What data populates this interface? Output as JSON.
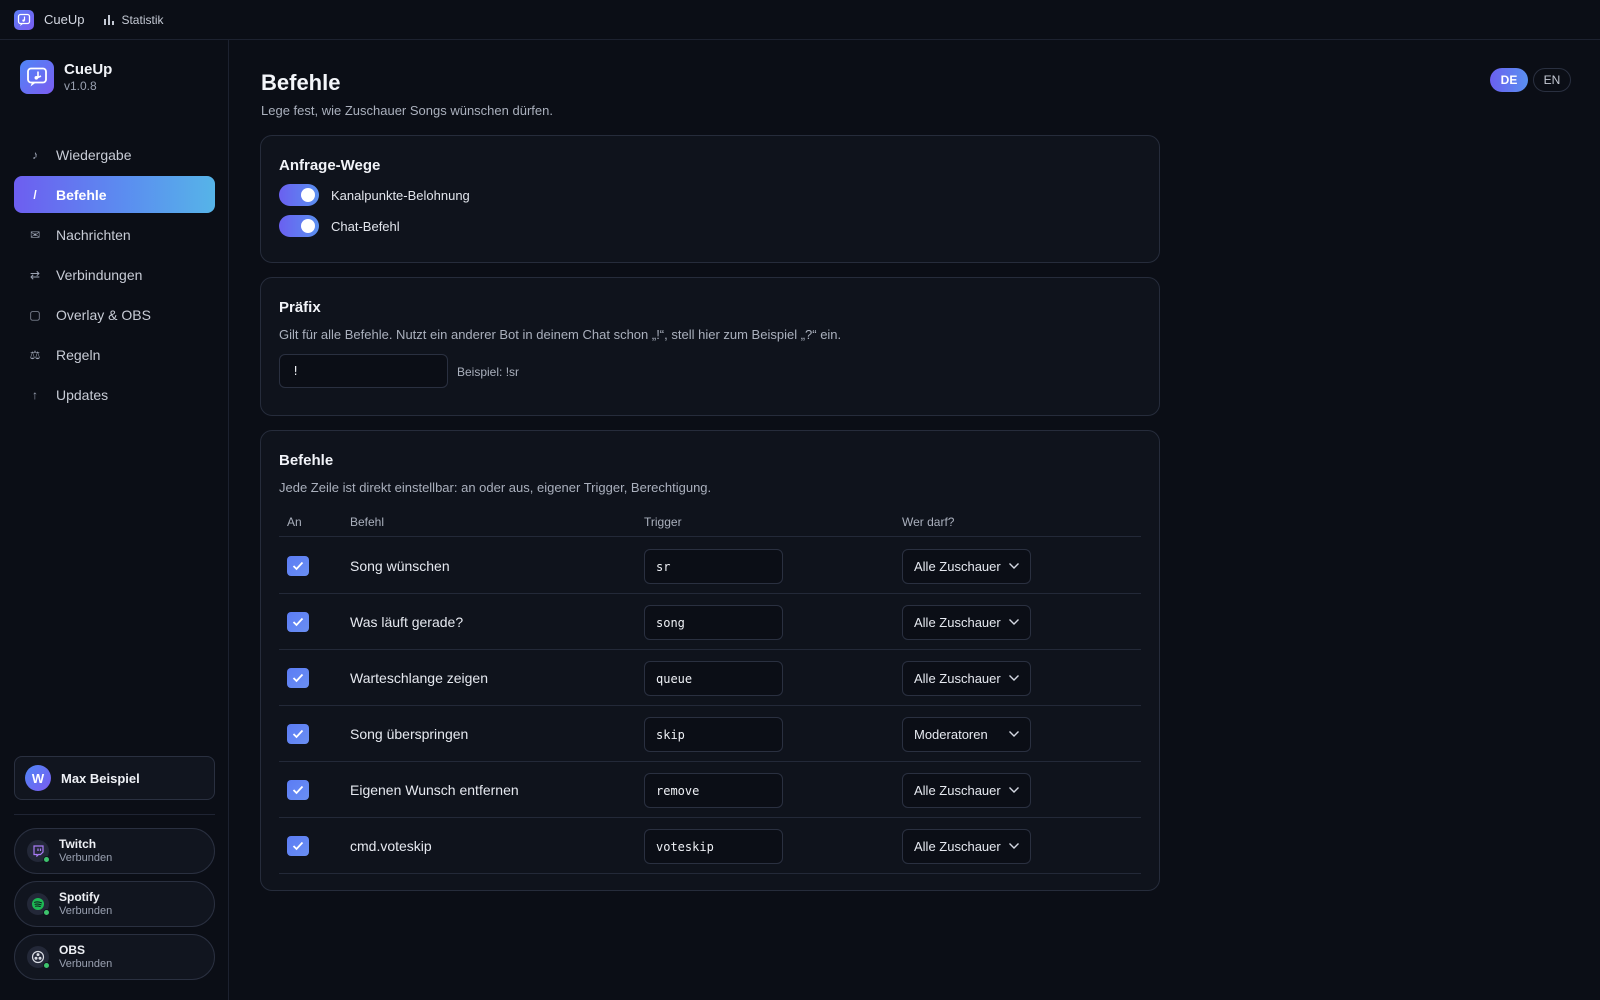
{
  "topbar": {
    "app_name": "CueUp",
    "stats_label": "Statistik"
  },
  "sidebar": {
    "brand": {
      "name": "CueUp",
      "version": "v1.0.8"
    },
    "items": [
      {
        "id": "wiedergabe",
        "label": "Wiedergabe",
        "icon": "♪"
      },
      {
        "id": "befehle",
        "label": "Befehle",
        "icon": "/"
      },
      {
        "id": "nachrichten",
        "label": "Nachrichten",
        "icon": "✉"
      },
      {
        "id": "verbindungen",
        "label": "Verbindungen",
        "icon": "⇄"
      },
      {
        "id": "overlay",
        "label": "Overlay & OBS",
        "icon": "▢"
      },
      {
        "id": "regeln",
        "label": "Regeln",
        "icon": "⚖"
      },
      {
        "id": "updates",
        "label": "Updates",
        "icon": "↑"
      }
    ],
    "active": "befehle",
    "user": {
      "initial": "W",
      "name": "Max Beispiel"
    },
    "services": [
      {
        "name": "Twitch",
        "status": "Verbunden",
        "icon": "twitch-icon"
      },
      {
        "name": "Spotify",
        "status": "Verbunden",
        "icon": "spotify-icon"
      },
      {
        "name": "OBS",
        "status": "Verbunden",
        "icon": "obs-icon"
      }
    ]
  },
  "lang": {
    "de": "DE",
    "en": "EN",
    "selected": "DE"
  },
  "page": {
    "title": "Befehle",
    "subtitle": "Lege fest, wie Zuschauer Songs wünschen dürfen."
  },
  "request_ways": {
    "title": "Anfrage-Wege",
    "channel_points": {
      "label": "Kanalpunkte-Belohnung",
      "enabled": true
    },
    "chat_command": {
      "label": "Chat-Befehl",
      "enabled": true
    }
  },
  "prefix": {
    "title": "Präfix",
    "description": "Gilt für alle Befehle. Nutzt ein anderer Bot in deinem Chat schon „!“, stell hier zum Beispiel „?“ ein.",
    "value": "!",
    "example": "Beispiel: !sr"
  },
  "commands": {
    "title": "Befehle",
    "description": "Jede Zeile ist direkt einstellbar: an oder aus, eigener Trigger, Berechtigung.",
    "headers": {
      "on": "An",
      "command": "Befehl",
      "trigger": "Trigger",
      "who": "Wer darf?"
    },
    "rows": [
      {
        "enabled": true,
        "name": "Song wünschen",
        "trigger": "sr",
        "permission": "Alle Zuschauer"
      },
      {
        "enabled": true,
        "name": "Was läuft gerade?",
        "trigger": "song",
        "permission": "Alle Zuschauer"
      },
      {
        "enabled": true,
        "name": "Warteschlange zeigen",
        "trigger": "queue",
        "permission": "Alle Zuschauer"
      },
      {
        "enabled": true,
        "name": "Song überspringen",
        "trigger": "skip",
        "permission": "Moderatoren"
      },
      {
        "enabled": true,
        "name": "Eigenen Wunsch entfernen",
        "trigger": "remove",
        "permission": "Alle Zuschauer"
      },
      {
        "enabled": true,
        "name": "cmd.voteskip",
        "trigger": "voteskip",
        "permission": "Alle Zuschauer"
      }
    ]
  },
  "colors": {
    "accent": "#6a60f0",
    "accent2": "#5a90f0",
    "online": "#3ec46d",
    "background": "#0b0e16"
  }
}
